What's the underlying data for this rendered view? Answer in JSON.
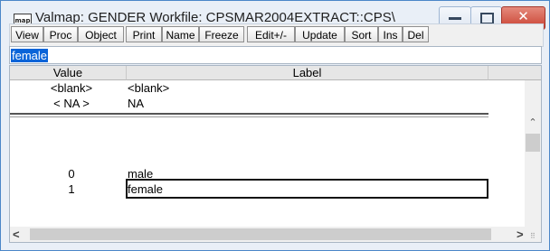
{
  "window": {
    "title": "Valmap: GENDER   Workfile: CPSMAR2004EXTRACT::CPS\\",
    "app_icon_text": "map"
  },
  "toolbar": {
    "buttons": [
      "View",
      "Proc",
      "Object",
      "Print",
      "Name",
      "Freeze",
      "Edit+/-",
      "Update",
      "Sort",
      "Ins",
      "Del"
    ]
  },
  "edit_field": {
    "value": "female"
  },
  "table": {
    "headers": {
      "value": "Value",
      "label": "Label"
    },
    "special_rows": [
      {
        "value": "<blank>",
        "label": "<blank>"
      },
      {
        "value": "< NA >",
        "label": "NA"
      }
    ],
    "rows": [
      {
        "value": "0",
        "label": "male"
      },
      {
        "value": "1",
        "label": "female"
      }
    ],
    "selected_row": 1
  },
  "icons": {
    "app": "map-icon",
    "minimize": "minimize-icon",
    "maximize": "maximize-icon",
    "close": "close-icon",
    "scroll_up": "chevron-up-icon",
    "scroll_down": "chevron-down-icon",
    "scroll_left": "chevron-left-icon",
    "scroll_right": "chevron-right-icon"
  },
  "colors": {
    "selection": "#0a64d8",
    "close_button": "#c94030",
    "window_border": "#4b87c8"
  }
}
